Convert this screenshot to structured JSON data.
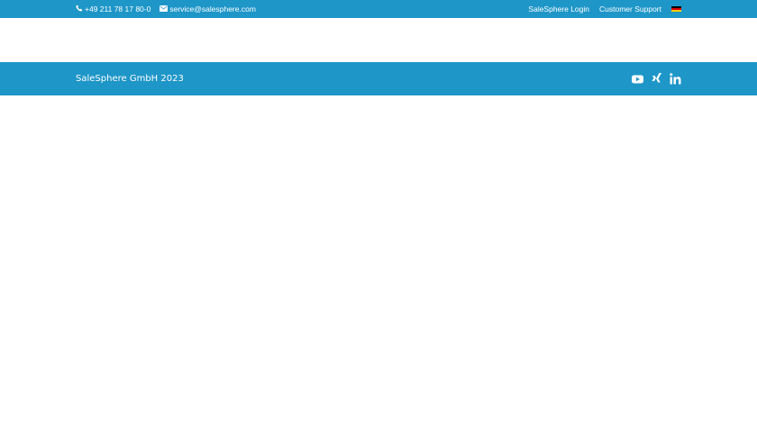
{
  "topbar": {
    "phone": "+49 211 78 17 80-0",
    "email": "service@salesphere.com",
    "links": [
      "SaleSphere Login",
      "Customer Support"
    ],
    "language_flag": "de-flag-icon"
  },
  "footer": {
    "copyright": "SaleSphere GmbH 2023",
    "social": [
      "youtube-icon",
      "xing-icon",
      "linkedin-icon"
    ]
  },
  "colors": {
    "brand_blue": "#1e96c8",
    "background": "#ffffff",
    "text_on_blue": "#ffffff"
  }
}
